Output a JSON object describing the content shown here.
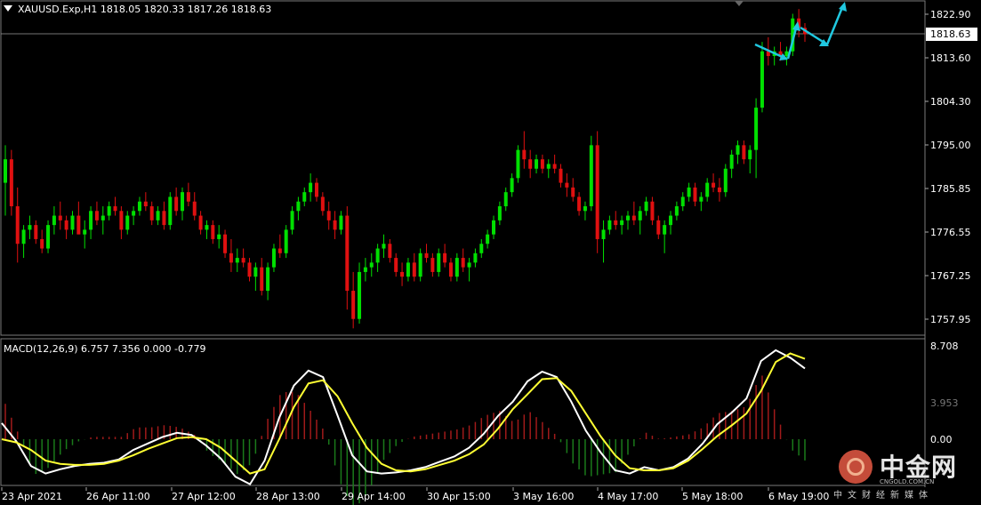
{
  "window": {
    "symbol_line": "XAUUSD.Exp,H1  1818.05 1820.33 1817.26 1818.63"
  },
  "price_axis": {
    "labels": [
      "1822.90",
      "1813.60",
      "1804.30",
      "1795.00",
      "1785.85",
      "1776.55",
      "1767.25",
      "1757.95"
    ],
    "current_price": "1818.63"
  },
  "macd": {
    "title": "MACD(12,26,9) 6.757 7.356 0.000 -0.779",
    "axis_labels": [
      "8.708",
      "0.00"
    ],
    "mid_label": "3.953"
  },
  "time_axis": {
    "labels": [
      "23 Apr 2021",
      "26 Apr 11:00",
      "27 Apr 12:00",
      "28 Apr 13:00",
      "29 Apr 14:00",
      "30 Apr 15:00",
      "3 May 16:00",
      "4 May 17:00",
      "5 May 18:00",
      "6 May 19:00"
    ]
  },
  "watermark": {
    "name": "中金网",
    "domain": "CNGOLD.COM.CN",
    "tagline": "中文财经新媒体"
  },
  "colors": {
    "bull": "#00e000",
    "bear": "#e01010",
    "macd_main": "#ffffff",
    "macd_signal": "#ffff33",
    "arrow": "#20c8e0"
  },
  "chart_data": {
    "type": "candlestick",
    "title": "XAUUSD.Exp,H1",
    "ylim": [
      1754,
      1825
    ],
    "ohlc": [
      [
        1787,
        1795,
        1780,
        1792
      ],
      [
        1792,
        1794,
        1780,
        1782
      ],
      [
        1782,
        1786,
        1770,
        1774
      ],
      [
        1774,
        1778,
        1771,
        1777
      ],
      [
        1777,
        1780,
        1775,
        1778
      ],
      [
        1778,
        1779,
        1774,
        1775
      ],
      [
        1775,
        1777,
        1772,
        1773
      ],
      [
        1773,
        1779,
        1772,
        1778
      ],
      [
        1778,
        1782,
        1776,
        1780
      ],
      [
        1780,
        1783,
        1777,
        1779
      ],
      [
        1779,
        1780,
        1775,
        1777
      ],
      [
        1777,
        1781,
        1776,
        1780
      ],
      [
        1780,
        1783,
        1778,
        1776
      ],
      [
        1776,
        1779,
        1773,
        1777
      ],
      [
        1777,
        1782,
        1775,
        1781
      ],
      [
        1781,
        1783,
        1778,
        1779
      ],
      [
        1779,
        1782,
        1776,
        1780
      ],
      [
        1780,
        1783,
        1779,
        1782
      ],
      [
        1782,
        1784,
        1780,
        1781
      ],
      [
        1781,
        1782,
        1775,
        1777
      ],
      [
        1777,
        1781,
        1776,
        1780
      ],
      [
        1780,
        1782,
        1778,
        1781
      ],
      [
        1781,
        1784,
        1780,
        1783
      ],
      [
        1783,
        1785,
        1781,
        1782
      ],
      [
        1782,
        1783,
        1778,
        1779
      ],
      [
        1779,
        1782,
        1778,
        1781
      ],
      [
        1781,
        1783,
        1777,
        1778
      ],
      [
        1778,
        1785,
        1777,
        1784
      ],
      [
        1784,
        1786,
        1780,
        1781
      ],
      [
        1781,
        1786,
        1779,
        1785
      ],
      [
        1785,
        1787,
        1782,
        1783
      ],
      [
        1783,
        1785,
        1779,
        1780
      ],
      [
        1780,
        1781,
        1776,
        1777
      ],
      [
        1777,
        1779,
        1775,
        1778
      ],
      [
        1778,
        1779,
        1774,
        1775
      ],
      [
        1775,
        1778,
        1773,
        1776
      ],
      [
        1776,
        1777,
        1771,
        1772
      ],
      [
        1772,
        1775,
        1768,
        1770
      ],
      [
        1770,
        1773,
        1768,
        1771
      ],
      [
        1771,
        1773,
        1769,
        1770
      ],
      [
        1770,
        1771,
        1766,
        1767
      ],
      [
        1767,
        1770,
        1764,
        1769
      ],
      [
        1769,
        1771,
        1763,
        1764
      ],
      [
        1764,
        1770,
        1762,
        1769
      ],
      [
        1769,
        1774,
        1768,
        1773
      ],
      [
        1773,
        1776,
        1771,
        1772
      ],
      [
        1772,
        1778,
        1771,
        1777
      ],
      [
        1777,
        1782,
        1776,
        1781
      ],
      [
        1781,
        1784,
        1779,
        1783
      ],
      [
        1783,
        1786,
        1782,
        1785
      ],
      [
        1785,
        1789,
        1783,
        1787
      ],
      [
        1787,
        1788,
        1783,
        1784
      ],
      [
        1784,
        1785,
        1780,
        1781
      ],
      [
        1781,
        1783,
        1777,
        1779
      ],
      [
        1779,
        1781,
        1775,
        1777
      ],
      [
        1777,
        1781,
        1776,
        1780
      ],
      [
        1780,
        1782,
        1760,
        1764
      ],
      [
        1764,
        1768,
        1756,
        1758
      ],
      [
        1758,
        1770,
        1757,
        1768
      ],
      [
        1768,
        1771,
        1766,
        1769
      ],
      [
        1769,
        1772,
        1767,
        1770
      ],
      [
        1770,
        1774,
        1768,
        1773
      ],
      [
        1773,
        1776,
        1771,
        1774
      ],
      [
        1774,
        1775,
        1770,
        1771
      ],
      [
        1771,
        1772,
        1767,
        1768
      ],
      [
        1768,
        1770,
        1765,
        1767
      ],
      [
        1767,
        1771,
        1766,
        1770
      ],
      [
        1770,
        1772,
        1766,
        1767
      ],
      [
        1767,
        1773,
        1766,
        1772
      ],
      [
        1772,
        1774,
        1770,
        1771
      ],
      [
        1771,
        1772,
        1767,
        1768
      ],
      [
        1768,
        1773,
        1767,
        1772
      ],
      [
        1772,
        1774,
        1769,
        1770
      ],
      [
        1770,
        1771,
        1766,
        1767
      ],
      [
        1767,
        1772,
        1766,
        1771
      ],
      [
        1771,
        1773,
        1768,
        1769
      ],
      [
        1769,
        1771,
        1766,
        1770
      ],
      [
        1770,
        1773,
        1769,
        1772
      ],
      [
        1772,
        1775,
        1771,
        1774
      ],
      [
        1774,
        1777,
        1773,
        1776
      ],
      [
        1776,
        1780,
        1775,
        1779
      ],
      [
        1779,
        1783,
        1778,
        1782
      ],
      [
        1782,
        1786,
        1781,
        1785
      ],
      [
        1785,
        1789,
        1784,
        1788
      ],
      [
        1788,
        1795,
        1787,
        1794
      ],
      [
        1794,
        1798,
        1790,
        1792
      ],
      [
        1792,
        1794,
        1788,
        1790
      ],
      [
        1790,
        1793,
        1789,
        1792
      ],
      [
        1792,
        1793,
        1789,
        1790
      ],
      [
        1790,
        1792,
        1788,
        1791
      ],
      [
        1791,
        1793,
        1789,
        1790
      ],
      [
        1790,
        1791,
        1786,
        1787
      ],
      [
        1787,
        1789,
        1784,
        1786
      ],
      [
        1786,
        1788,
        1783,
        1784
      ],
      [
        1784,
        1785,
        1780,
        1781
      ],
      [
        1781,
        1783,
        1779,
        1782
      ],
      [
        1782,
        1797,
        1781,
        1795
      ],
      [
        1795,
        1798,
        1772,
        1775
      ],
      [
        1775,
        1779,
        1770,
        1777
      ],
      [
        1777,
        1780,
        1776,
        1779
      ],
      [
        1779,
        1781,
        1777,
        1778
      ],
      [
        1778,
        1780,
        1776,
        1779
      ],
      [
        1779,
        1781,
        1777,
        1780
      ],
      [
        1780,
        1783,
        1778,
        1779
      ],
      [
        1779,
        1782,
        1776,
        1781
      ],
      [
        1781,
        1784,
        1780,
        1783
      ],
      [
        1783,
        1784,
        1778,
        1779
      ],
      [
        1779,
        1780,
        1775,
        1776
      ],
      [
        1776,
        1779,
        1772,
        1778
      ],
      [
        1778,
        1781,
        1776,
        1780
      ],
      [
        1780,
        1783,
        1779,
        1782
      ],
      [
        1782,
        1785,
        1781,
        1784
      ],
      [
        1784,
        1787,
        1783,
        1786
      ],
      [
        1786,
        1787,
        1782,
        1783
      ],
      [
        1783,
        1785,
        1781,
        1784
      ],
      [
        1784,
        1788,
        1783,
        1787
      ],
      [
        1787,
        1789,
        1785,
        1786
      ],
      [
        1786,
        1788,
        1783,
        1785
      ],
      [
        1785,
        1791,
        1784,
        1790
      ],
      [
        1790,
        1794,
        1788,
        1793
      ],
      [
        1793,
        1796,
        1791,
        1795
      ],
      [
        1795,
        1796,
        1791,
        1792
      ],
      [
        1792,
        1795,
        1789,
        1794
      ],
      [
        1794,
        1805,
        1788,
        1803
      ],
      [
        1803,
        1817,
        1802,
        1815
      ],
      [
        1815,
        1818,
        1812,
        1814
      ],
      [
        1814,
        1816,
        1812,
        1815
      ],
      [
        1815,
        1817,
        1813,
        1814
      ],
      [
        1814,
        1816,
        1812,
        1815
      ],
      [
        1815,
        1823,
        1814,
        1822
      ],
      [
        1822,
        1824,
        1818,
        1820
      ],
      [
        1820,
        1821,
        1817,
        1818.63
      ]
    ],
    "macd_main": [
      1.5,
      -0.2,
      -2.5,
      -3.2,
      -2.8,
      -2.5,
      -2.3,
      -2.2,
      -1.9,
      -1.0,
      -0.4,
      0.2,
      0.6,
      0.4,
      -0.6,
      -1.8,
      -3.5,
      -4.2,
      -2.0,
      2.0,
      5.0,
      6.4,
      5.8,
      2.2,
      -1.5,
      -3.0,
      -3.2,
      -3.1,
      -2.9,
      -2.6,
      -2.1,
      -1.6,
      -0.8,
      0.5,
      2.2,
      3.5,
      5.4,
      6.3,
      5.8,
      3.5,
      0.8,
      -1.2,
      -2.9,
      -3.2,
      -2.6,
      -2.9,
      -2.6,
      -1.8,
      -0.4,
      1.4,
      2.5,
      3.8,
      7.3,
      8.3,
      7.6,
      6.6
    ],
    "macd_signal": [
      0.0,
      -0.3,
      -1.0,
      -2.0,
      -2.3,
      -2.4,
      -2.4,
      -2.3,
      -2.0,
      -1.5,
      -0.9,
      -0.4,
      0.1,
      0.2,
      0.0,
      -0.8,
      -2.0,
      -3.2,
      -2.8,
      0.0,
      3.0,
      5.2,
      5.5,
      4.0,
      1.5,
      -0.8,
      -2.3,
      -2.9,
      -3.0,
      -2.8,
      -2.4,
      -2.0,
      -1.4,
      -0.5,
      1.0,
      2.8,
      4.2,
      5.6,
      5.7,
      4.5,
      2.4,
      0.3,
      -1.5,
      -2.7,
      -2.9,
      -2.9,
      -2.7,
      -2.0,
      -0.9,
      0.3,
      1.3,
      2.4,
      4.5,
      7.2,
      8.0,
      7.5
    ],
    "macd_ylim": [
      -4.5,
      9.5
    ]
  }
}
